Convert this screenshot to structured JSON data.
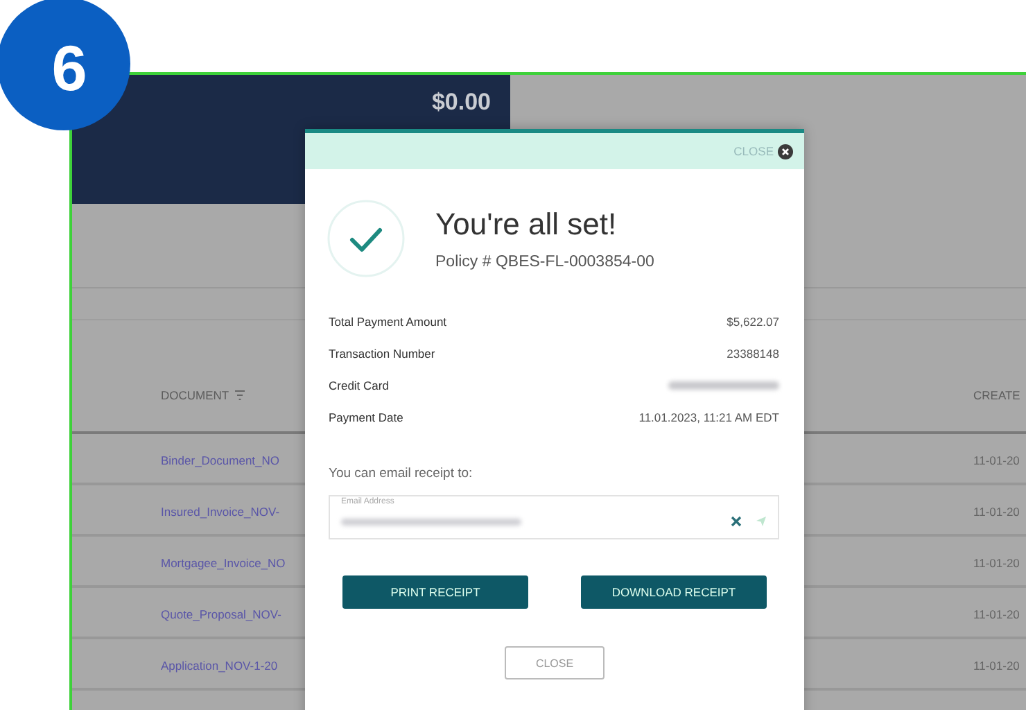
{
  "step_badge": "6",
  "background": {
    "amount_due": "$0.00",
    "table": {
      "columns": [
        {
          "label": "DOCUMENT",
          "filter": true
        },
        {
          "label": "CREATE"
        }
      ],
      "rows": [
        {
          "document": "Binder_Document_NO",
          "created": "11-01-20"
        },
        {
          "document": "Insured_Invoice_NOV-",
          "created": "11-01-20"
        },
        {
          "document": "Mortgagee_Invoice_NO",
          "created": "11-01-20"
        },
        {
          "document": "Quote_Proposal_NOV-",
          "created": "11-01-20"
        },
        {
          "document": "Application_NOV-1-20",
          "created": "11-01-20"
        }
      ]
    }
  },
  "modal": {
    "header_close": "CLOSE",
    "title": "You're all set!",
    "policy": "Policy # QBES-FL-0003854-00",
    "details": [
      {
        "label": "Total Payment Amount",
        "value": "$5,622.07",
        "redacted": false
      },
      {
        "label": "Transaction Number",
        "value": "23388148",
        "redacted": false
      },
      {
        "label": "Credit Card",
        "redacted": true
      },
      {
        "label": "Payment Date",
        "value": "11.01.2023, 11:21 AM EDT",
        "redacted": false
      }
    ],
    "email_prompt": "You can email receipt to:",
    "email_field": {
      "label": "Email Address",
      "redacted": true
    },
    "buttons": [
      "PRINT RECEIPT",
      "DOWNLOAD RECEIPT"
    ],
    "close_button": "CLOSE"
  }
}
